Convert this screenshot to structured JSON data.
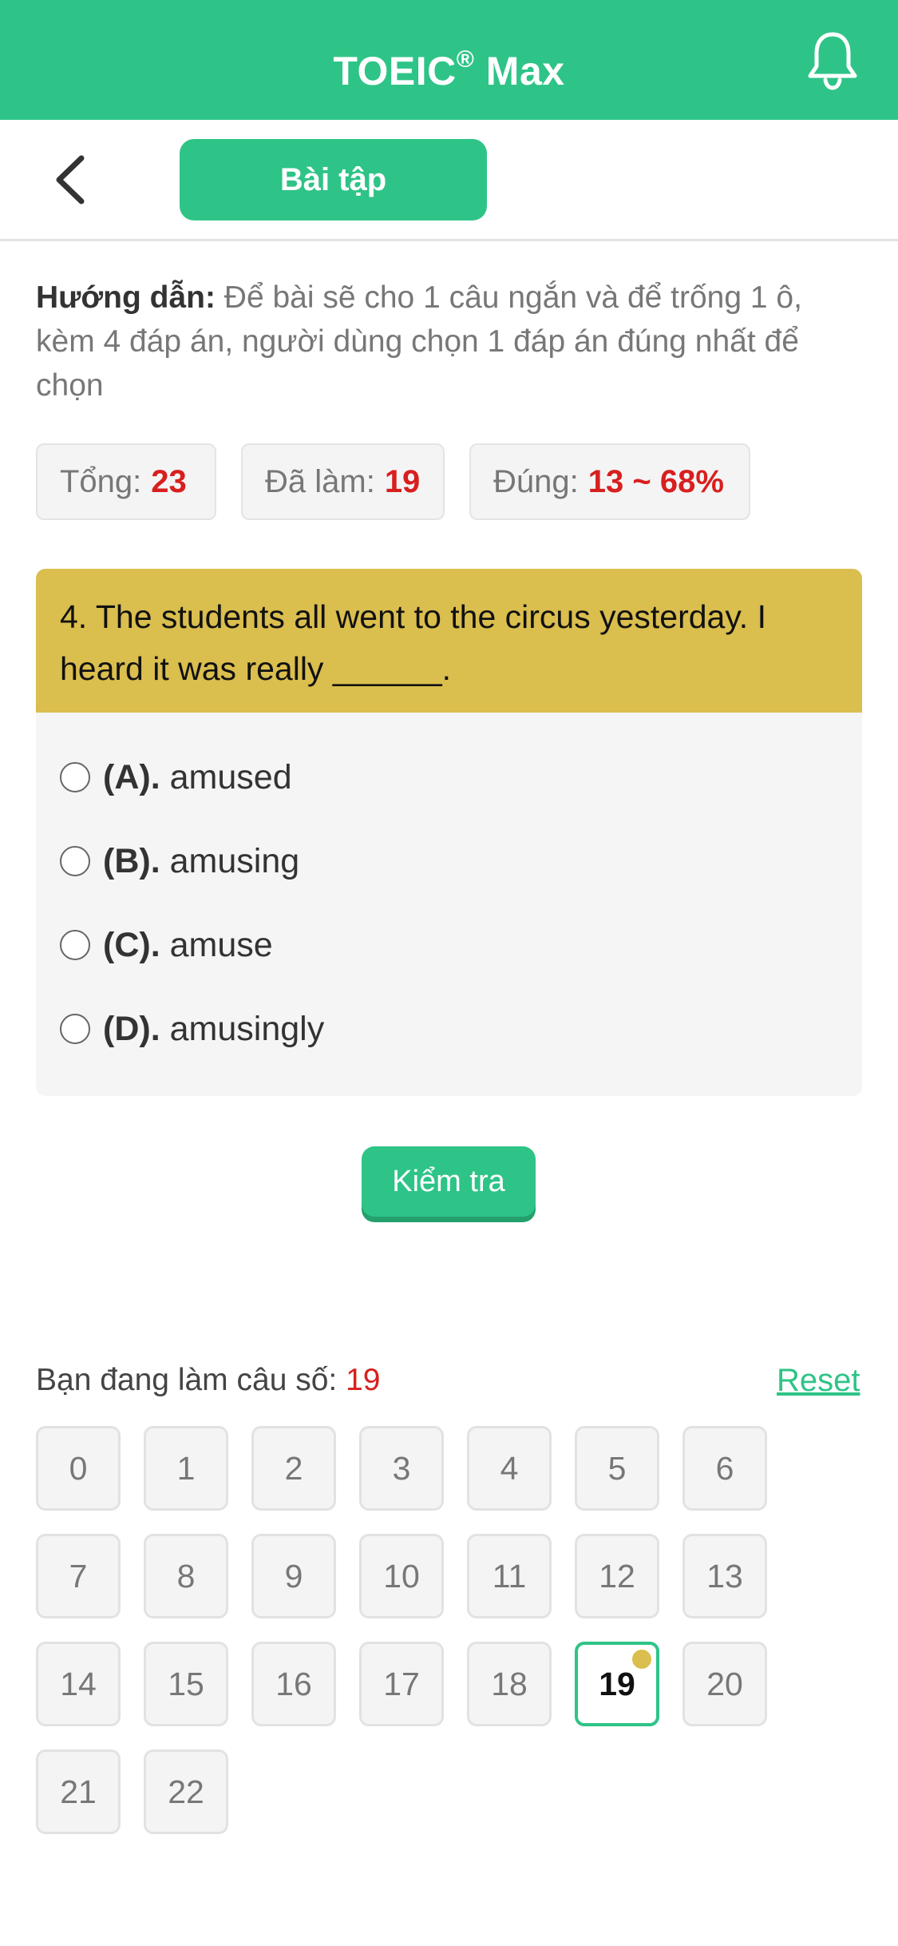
{
  "header": {
    "title": "TOEIC",
    "title_mark": "®",
    "title_suffix": " Max",
    "tab_label": "Bài tập",
    "accent": "#2ec487",
    "icons": [
      "bell-icon",
      "back-chevron-icon"
    ]
  },
  "guide": {
    "label": "Hướng dẫn:",
    "text": " Để bài sẽ cho 1 câu ngắn và để trống 1 ô, kèm 4 đáp án, người dùng chọn 1 đáp án đúng nhất để chọn"
  },
  "stats": [
    {
      "label": "Tổng:",
      "value": "23"
    },
    {
      "label": "Đã làm:",
      "value": "19"
    },
    {
      "label": "Đúng:",
      "value": "13 ~ 68%"
    }
  ],
  "question": {
    "text": "4. The students all went to the circus yesterday. I heard it was really ______.",
    "color": "#dabe4e",
    "options": [
      {
        "key": "(A).",
        "text": "amused"
      },
      {
        "key": "(B).",
        "text": "amusing"
      },
      {
        "key": "(C).",
        "text": "amuse"
      },
      {
        "key": "(D).",
        "text": "amusingly"
      }
    ]
  },
  "check_label": "Kiểm tra",
  "progress": {
    "label": "Bạn đang làm câu số:",
    "current": "19",
    "reset_label": "Reset",
    "numbers": [
      "0",
      "1",
      "2",
      "3",
      "4",
      "5",
      "6",
      "7",
      "8",
      "9",
      "10",
      "11",
      "12",
      "13",
      "14",
      "15",
      "16",
      "17",
      "18",
      "19",
      "20",
      "21",
      "22"
    ],
    "active_index": 19
  }
}
